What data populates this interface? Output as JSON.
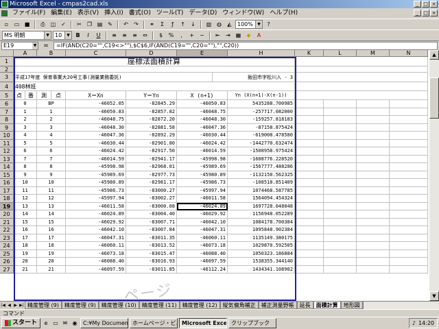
{
  "window": {
    "title": "Microsoft Excel - cmpas2cad.xls",
    "buttons": [
      "_",
      "□",
      "×"
    ]
  },
  "menu": [
    "ファイル(F)",
    "編集(E)",
    "表示(V)",
    "挿入(I)",
    "書式(O)",
    "ツール(T)",
    "データ(D)",
    "ウィンドウ(W)",
    "ヘルプ(H)"
  ],
  "toolbar": {
    "font_name": "MS 明朝",
    "font_size": "10",
    "zoom": "100%"
  },
  "formula_bar": {
    "name_box": "E19",
    "eq": "=",
    "formula": "=IF(AND(C20=\"\",C19<>\"\"),$C$6,IF(AND(C19=\"\",C20=\"\"),\"\",C20))"
  },
  "columns": [
    "A",
    "B",
    "C",
    "D",
    "E",
    "F",
    "G",
    "H",
    "I",
    "J",
    "K",
    "L",
    "M",
    "N"
  ],
  "selected_col": "E",
  "selected_row": "19",
  "sheet": {
    "title": "座標法面積計算",
    "subtitle_left": "平成17年度  保育事業大20号工事(測量業務委託)",
    "subtitle_right": "飯田市字松川入 - 3",
    "block_label": "408林班",
    "headers": [
      "点",
      "番",
      "測",
      "点",
      "X＝Xn",
      "Y＝Yn",
      "X (n+1)",
      "Yn (X(n+1)-X(n-1))"
    ],
    "rows": [
      {
        "r": "6",
        "a": "0",
        "b": "BP",
        "c": "-46052.05",
        "d": "-82845.29",
        "e": "-46050.83",
        "h": "5435288.700985"
      },
      {
        "r": "7",
        "a": "1",
        "b": "1",
        "c": "-46050.83",
        "d": "-82857.82",
        "e": "-46048.75",
        "h": "-257717.082000"
      },
      {
        "r": "8",
        "a": "2",
        "b": "2",
        "c": "-46048.75",
        "d": "-82872.20",
        "e": "-46048.30",
        "h": "-159257.818183"
      },
      {
        "r": "9",
        "a": "3",
        "b": "3",
        "c": "-46048.30",
        "d": "-82881.58",
        "e": "-46047.36",
        "h": "-87158.875424"
      },
      {
        "r": "10",
        "a": "4",
        "b": "4",
        "c": "-46047.36",
        "d": "-82892.29",
        "e": "-46030.44",
        "h": "-619008.478580"
      },
      {
        "r": "11",
        "a": "5",
        "b": "5",
        "c": "-46030.44",
        "d": "-82901.80",
        "e": "-46024.42",
        "h": "-1442770.632474"
      },
      {
        "r": "12",
        "a": "6",
        "b": "6",
        "c": "-46024.42",
        "d": "-82917.50",
        "e": "-46014.59",
        "h": "-1508958.975424"
      },
      {
        "r": "13",
        "a": "7",
        "b": "7",
        "c": "-46014.59",
        "d": "-82941.17",
        "e": "-45998.98",
        "h": "-1608776.228520"
      },
      {
        "r": "14",
        "a": "8",
        "b": "8",
        "c": "-45998.98",
        "d": "-82968.01",
        "e": "-45989.69",
        "h": "-1567777.488286"
      },
      {
        "r": "15",
        "a": "9",
        "b": "9",
        "c": "-45989.69",
        "d": "-82977.73",
        "e": "-45980.89",
        "h": "-1132150.562325"
      },
      {
        "r": "16",
        "a": "10",
        "b": "10",
        "c": "-45980.89",
        "d": "-82981.17",
        "e": "-45986.73",
        "h": "-108518.851409"
      },
      {
        "r": "17",
        "a": "11",
        "b": "11",
        "c": "-45986.73",
        "d": "-83000.27",
        "e": "-45997.94",
        "h": "1074468.587785"
      },
      {
        "r": "18",
        "a": "12",
        "b": "12",
        "c": "-45997.94",
        "d": "-83002.27",
        "e": "-46011.58",
        "h": "1564094.454324"
      },
      {
        "r": "19",
        "a": "13",
        "b": "13",
        "c": "-46011.58",
        "d": "-83000.08",
        "e": "-46024.89",
        "h": "1697728.048048"
      },
      {
        "r": "20",
        "a": "14",
        "b": "14",
        "c": "-46024.89",
        "d": "-83004.40",
        "e": "-46029.92",
        "h": "1156948.052289"
      },
      {
        "r": "21",
        "a": "15",
        "b": "15",
        "c": "-46029.92",
        "d": "-83007.71",
        "e": "-46042.10",
        "h": "1084178.700384"
      },
      {
        "r": "22",
        "a": "16",
        "b": "16",
        "c": "-46042.10",
        "d": "-83007.84",
        "e": "-46047.31",
        "h": "1095848.902384"
      },
      {
        "r": "23",
        "a": "17",
        "b": "17",
        "c": "-46047.31",
        "d": "-83011.35",
        "e": "-46060.11",
        "h": "1135149.380175"
      },
      {
        "r": "24",
        "a": "18",
        "b": "18",
        "c": "-46060.11",
        "d": "-83013.52",
        "e": "-46073.18",
        "h": "1029870.592505"
      },
      {
        "r": "25",
        "a": "19",
        "b": "19",
        "c": "-46073.18",
        "d": "-83015.47",
        "e": "-46088.40",
        "h": "1050323.186884"
      },
      {
        "r": "26",
        "a": "20",
        "b": "20",
        "c": "-46088.40",
        "d": "-83016.93",
        "e": "-46097.59",
        "h": "1538355.344140"
      },
      {
        "r": "27",
        "a": "21",
        "b": "21",
        "c": "-46097.59",
        "d": "-83011.85",
        "e": "-46112.24",
        "h": "1434341.108902"
      }
    ]
  },
  "tabs": [
    "精度管理 (9)",
    "精度管理 (9)",
    "精度管理 (10)",
    "精度管理 (11)",
    "精度管理 (12)",
    "縦気偏角補正",
    "補正測量野帳",
    "延長",
    "面積計算",
    "地形図"
  ],
  "active_tab": "面積計算",
  "status": "コマンド",
  "watermark": "ページ",
  "taskbar": {
    "start": "スタート",
    "tasks": [
      "C:¥My Documents...",
      "ホームページ・ビルダ...",
      "Microsoft Exce...",
      "クリップブック"
    ],
    "active_task": "Microsoft Exce...",
    "clock": "14:20"
  }
}
